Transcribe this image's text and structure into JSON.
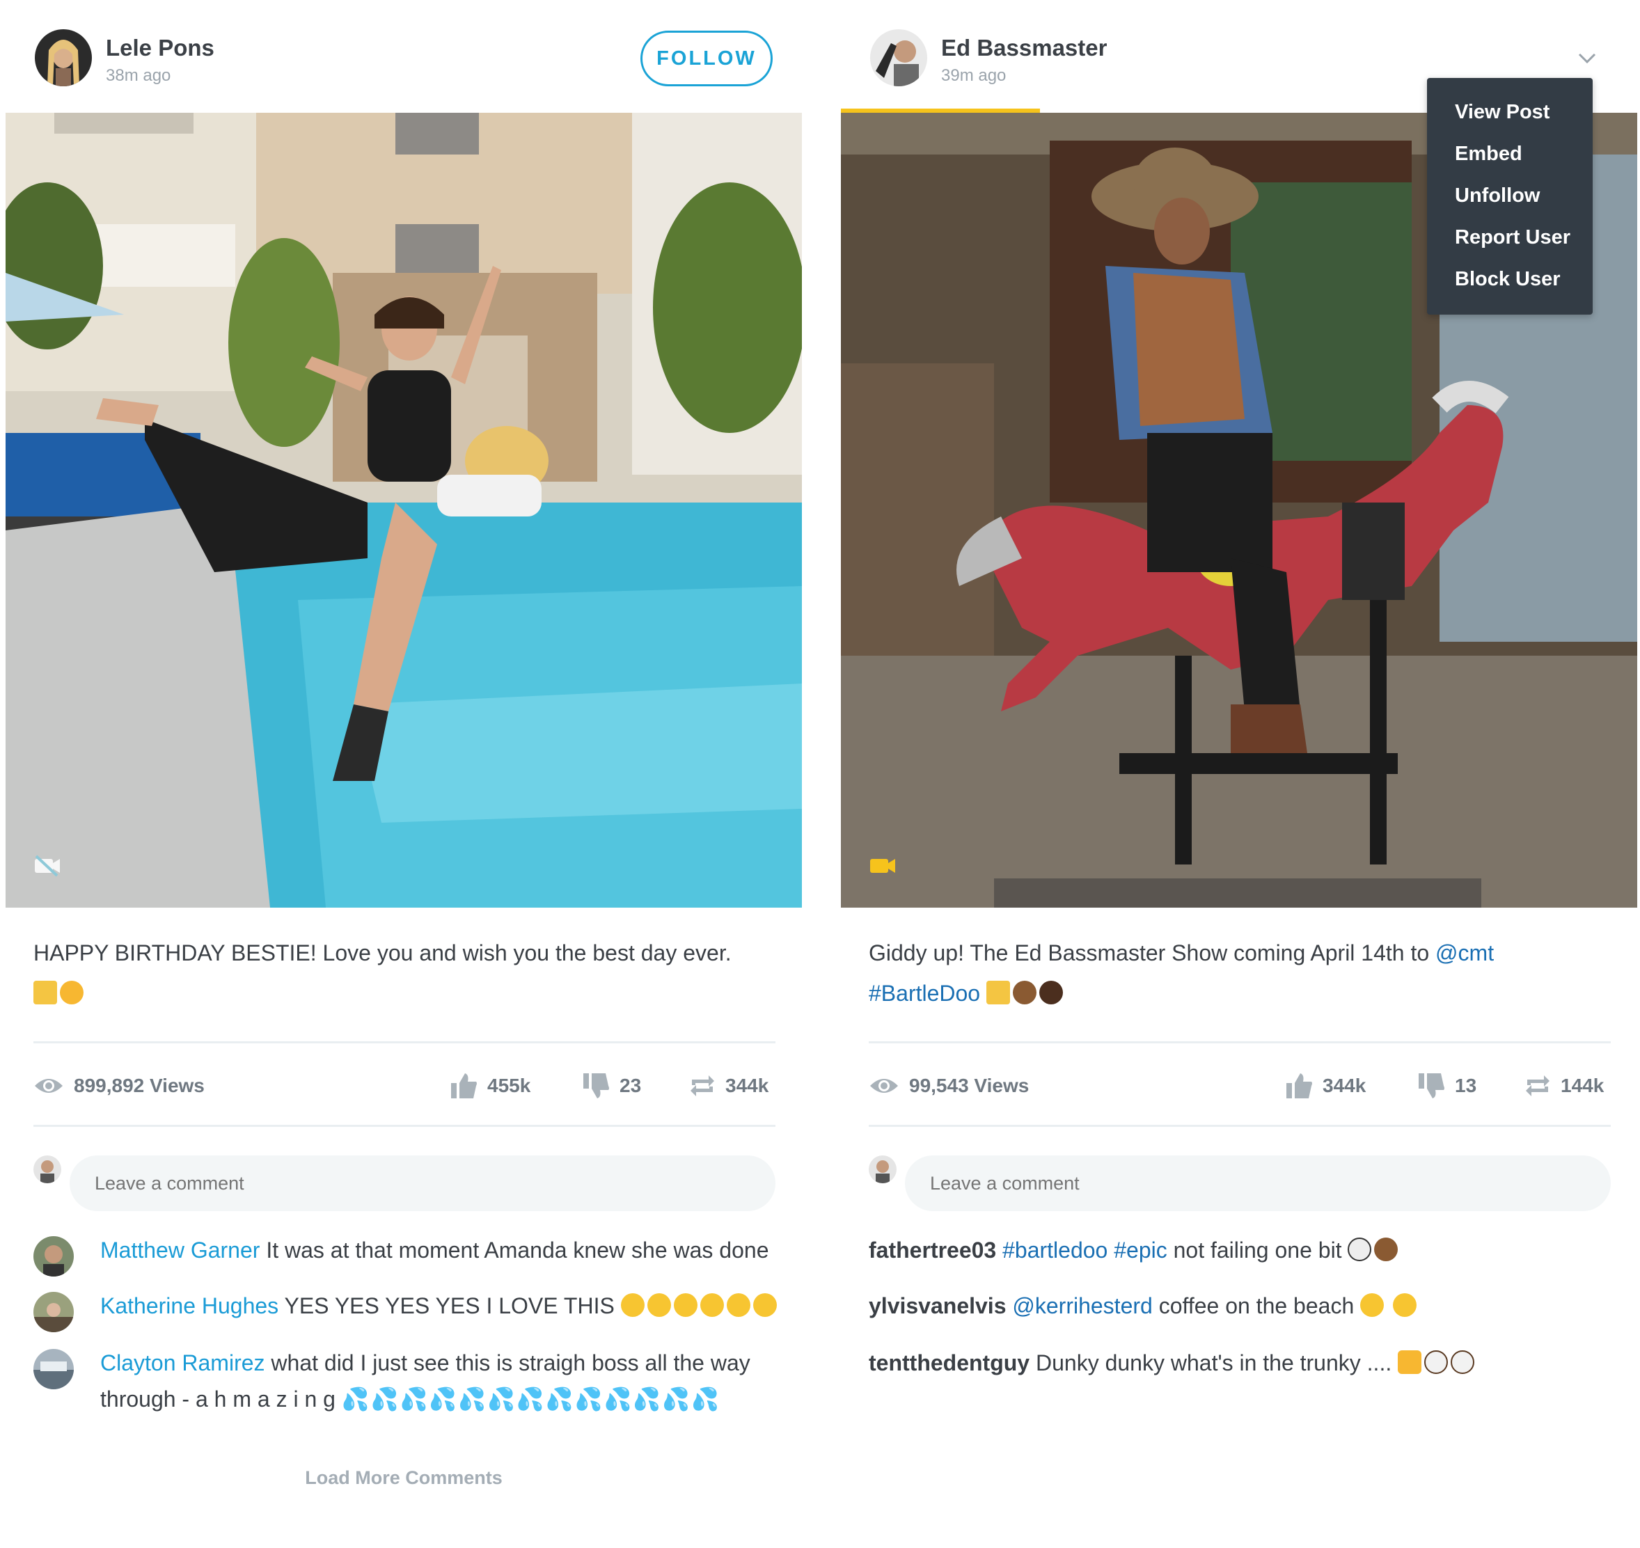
{
  "posts": [
    {
      "user": "Lele Pons",
      "time": "38m ago",
      "follow_label": "FOLLOW",
      "caption_text": "HAPPY BIRTHDAY BESTIE! Love you and wish you the best day ever.",
      "views": "899,892 Views",
      "likes": "455k",
      "dislikes": "23",
      "reposts": "344k",
      "comment_placeholder": "Leave a comment",
      "comments": [
        {
          "user": "Matthew Garner",
          "text": "It was at that moment Amanda knew she was done"
        },
        {
          "user": "Katherine Hughes",
          "text": "YES YES YES YES I LOVE THIS"
        },
        {
          "user": "Clayton Ramirez",
          "text": "what did I just see this is straigh boss all the way through - a h m a z i n g"
        }
      ],
      "load_more": "Load More Comments"
    },
    {
      "user": "Ed Bassmaster",
      "time": "39m ago",
      "caption_text": "Giddy up! The Ed Bassmaster Show coming April 14th to",
      "caption_mention": "@cmt",
      "caption_hashtag": "#BartleDoo",
      "views": "99,543 Views",
      "likes": "344k",
      "dislikes": "13",
      "reposts": "144k",
      "comment_placeholder": "Leave a comment",
      "comments": [
        {
          "user": "fathertree03",
          "tag1": "#bartledoo",
          "tag2": "#epic",
          "text": "not failing one bit"
        },
        {
          "user": "ylvisvanelvis",
          "mention": "@kerrihesterd",
          "text": "coffee on the beach"
        },
        {
          "user": "tentthedentguy",
          "text": "Dunky dunky what's in the trunky ...."
        }
      ]
    }
  ],
  "menu": {
    "items": [
      "View Post",
      "Embed",
      "Unfollow",
      "Report User",
      "Block User"
    ]
  },
  "colors": {
    "accent": "#1aa3d6",
    "link": "#1a6fb3",
    "progress": "#f6c31c",
    "menu_bg": "#333c45"
  }
}
